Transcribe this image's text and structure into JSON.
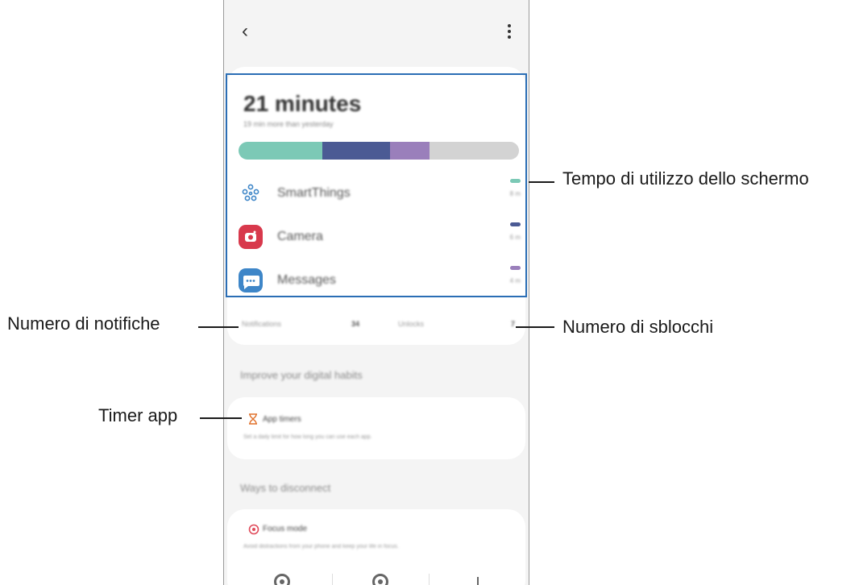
{
  "toolbar": {
    "back_icon": "‹",
    "more_icon": "vertical-dots"
  },
  "screen_time": {
    "total": "21 minutes",
    "subtitle": "19 min more than yesterday",
    "segments": [
      {
        "color": "#7cc9b6",
        "fraction": 0.3
      },
      {
        "color": "#4b5a94",
        "fraction": 0.24
      },
      {
        "color": "#9a7fbb",
        "fraction": 0.14
      },
      {
        "color": "#d3d3d3",
        "fraction": 0.32
      }
    ],
    "apps": [
      {
        "name": "SmartThings",
        "time": "8 m",
        "mark_color": "#7cc9b6",
        "icon_bg": "#ffffff",
        "icon": "smartthings-icon"
      },
      {
        "name": "Camera",
        "time": "6 m",
        "mark_color": "#4b5a94",
        "icon_bg": "#d8394c",
        "icon": "camera-icon"
      },
      {
        "name": "Messages",
        "time": "4 m",
        "mark_color": "#9a7fbb",
        "icon_bg": "#3e86c8",
        "icon": "messages-icon"
      }
    ]
  },
  "stats": {
    "notifications_label": "Notifications",
    "notifications_value": "34",
    "unlocks_label": "Unlocks",
    "unlocks_value": "7"
  },
  "improve": {
    "title": "Improve your digital habits",
    "app_timers_label": "App timers",
    "app_timers_desc": "Set a daily limit for how long you can use each app."
  },
  "disconnect": {
    "title": "Ways to disconnect",
    "focus_label": "Focus mode",
    "focus_desc": "Avoid distractions from your phone and keep your life in focus."
  },
  "callouts": {
    "screen_time": "Tempo di utilizzo dello schermo",
    "notifications": "Numero di notifiche",
    "unlocks": "Numero di sblocchi",
    "app_timer": "Timer app"
  },
  "colors": {
    "highlight": "#2b6eb5",
    "timer_icon": "#e0702a",
    "focus_icon": "#e04a5a"
  }
}
